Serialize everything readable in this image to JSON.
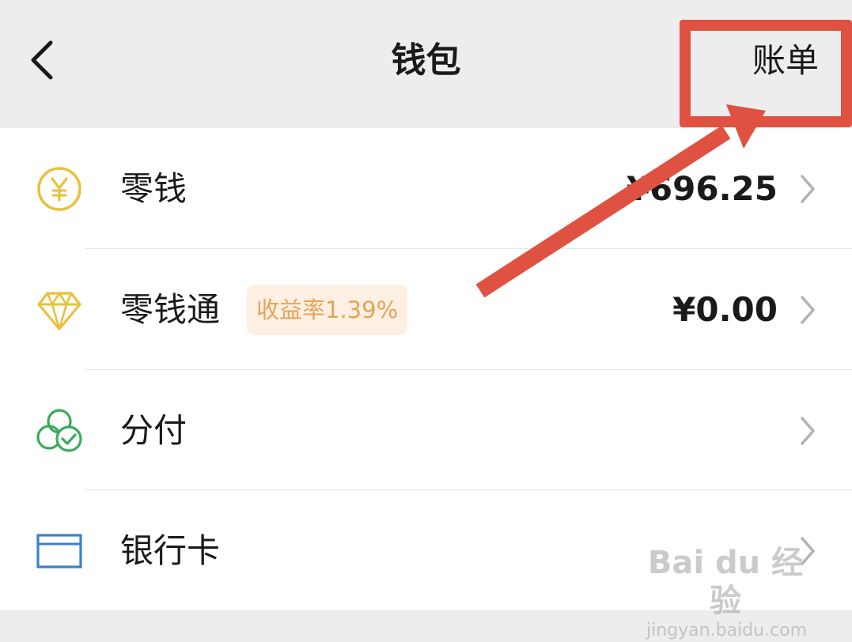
{
  "header": {
    "back_icon": "chevron-left-icon",
    "title": "钱包",
    "bill_label": "账单"
  },
  "rows": [
    {
      "icon": "yuan-coin-icon",
      "label": "零钱",
      "value": "¥696.25"
    },
    {
      "icon": "diamond-icon",
      "label": "零钱通",
      "badge": "收益率1.39%",
      "value": "¥0.00"
    },
    {
      "icon": "installment-pay-icon",
      "label": "分付",
      "value": ""
    },
    {
      "icon": "bank-card-icon",
      "label": "银行卡",
      "value": ""
    }
  ],
  "annotation": {
    "highlight_color": "#df5140"
  },
  "watermark": {
    "main": "Bai du 经验",
    "sub": "jingyan.baidu.com"
  },
  "colors": {
    "header_bg": "#ededed",
    "coin_yellow": "#e9c13b",
    "pay_green": "#3aab5c",
    "card_blue": "#3f80c8",
    "badge_bg": "#fdf0e2",
    "badge_text": "#e3a458"
  }
}
